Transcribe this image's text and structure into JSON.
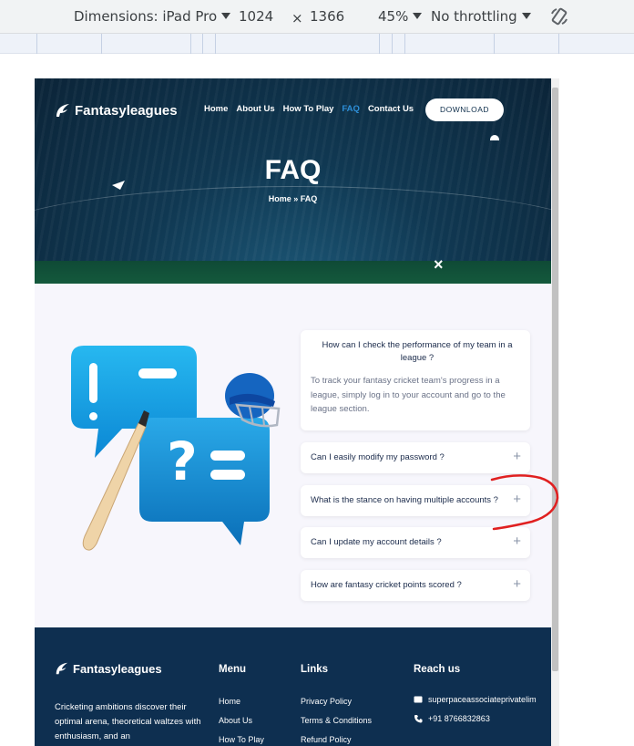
{
  "devtools": {
    "dimensions_label": "Dimensions: iPad Pro",
    "width": "1024",
    "times": "×",
    "height": "1366",
    "zoom": "45%",
    "throttling": "No throttling",
    "rotate_icon": "rotate-icon"
  },
  "header": {
    "logo_text": "Fantasyleagues",
    "nav": [
      "Home",
      "About Us",
      "How To Play",
      "FAQ",
      "Contact Us"
    ],
    "active_nav": "FAQ",
    "download_label": "DOWNLOAD"
  },
  "hero": {
    "title": "FAQ",
    "breadcrumb": "Home  »  FAQ",
    "close_icon": "×"
  },
  "faq": {
    "open_item": {
      "question": "How can I check the performance of my team in a league ?",
      "answer": "To track your fantasy cricket team's progress in a league, simply log in to your account and go to the league section."
    },
    "items": [
      "Can I easily modify my password ?",
      "What is the stance on having multiple accounts ?",
      "Can I update my account details ?",
      "How are fantasy cricket points scored ?"
    ],
    "expand_symbol": "+"
  },
  "footer": {
    "logo_text": "Fantasyleagues",
    "description": "Cricketing ambitions discover their optimal arena, theoretical waltzes with enthusiasm, and an",
    "menu_title": "Menu",
    "menu_items": [
      "Home",
      "About Us",
      "How To Play"
    ],
    "links_title": "Links",
    "links_items": [
      "Privacy Policy",
      "Terms & Conditions",
      "Refund Policy"
    ],
    "reach_title": "Reach us",
    "email": "superpaceassociateprivatelim",
    "phone": "+91 8766832863"
  },
  "colors": {
    "accent_blue": "#2d8fd8",
    "footer_bg": "#0e2f50",
    "annotation_red": "#e02020"
  }
}
